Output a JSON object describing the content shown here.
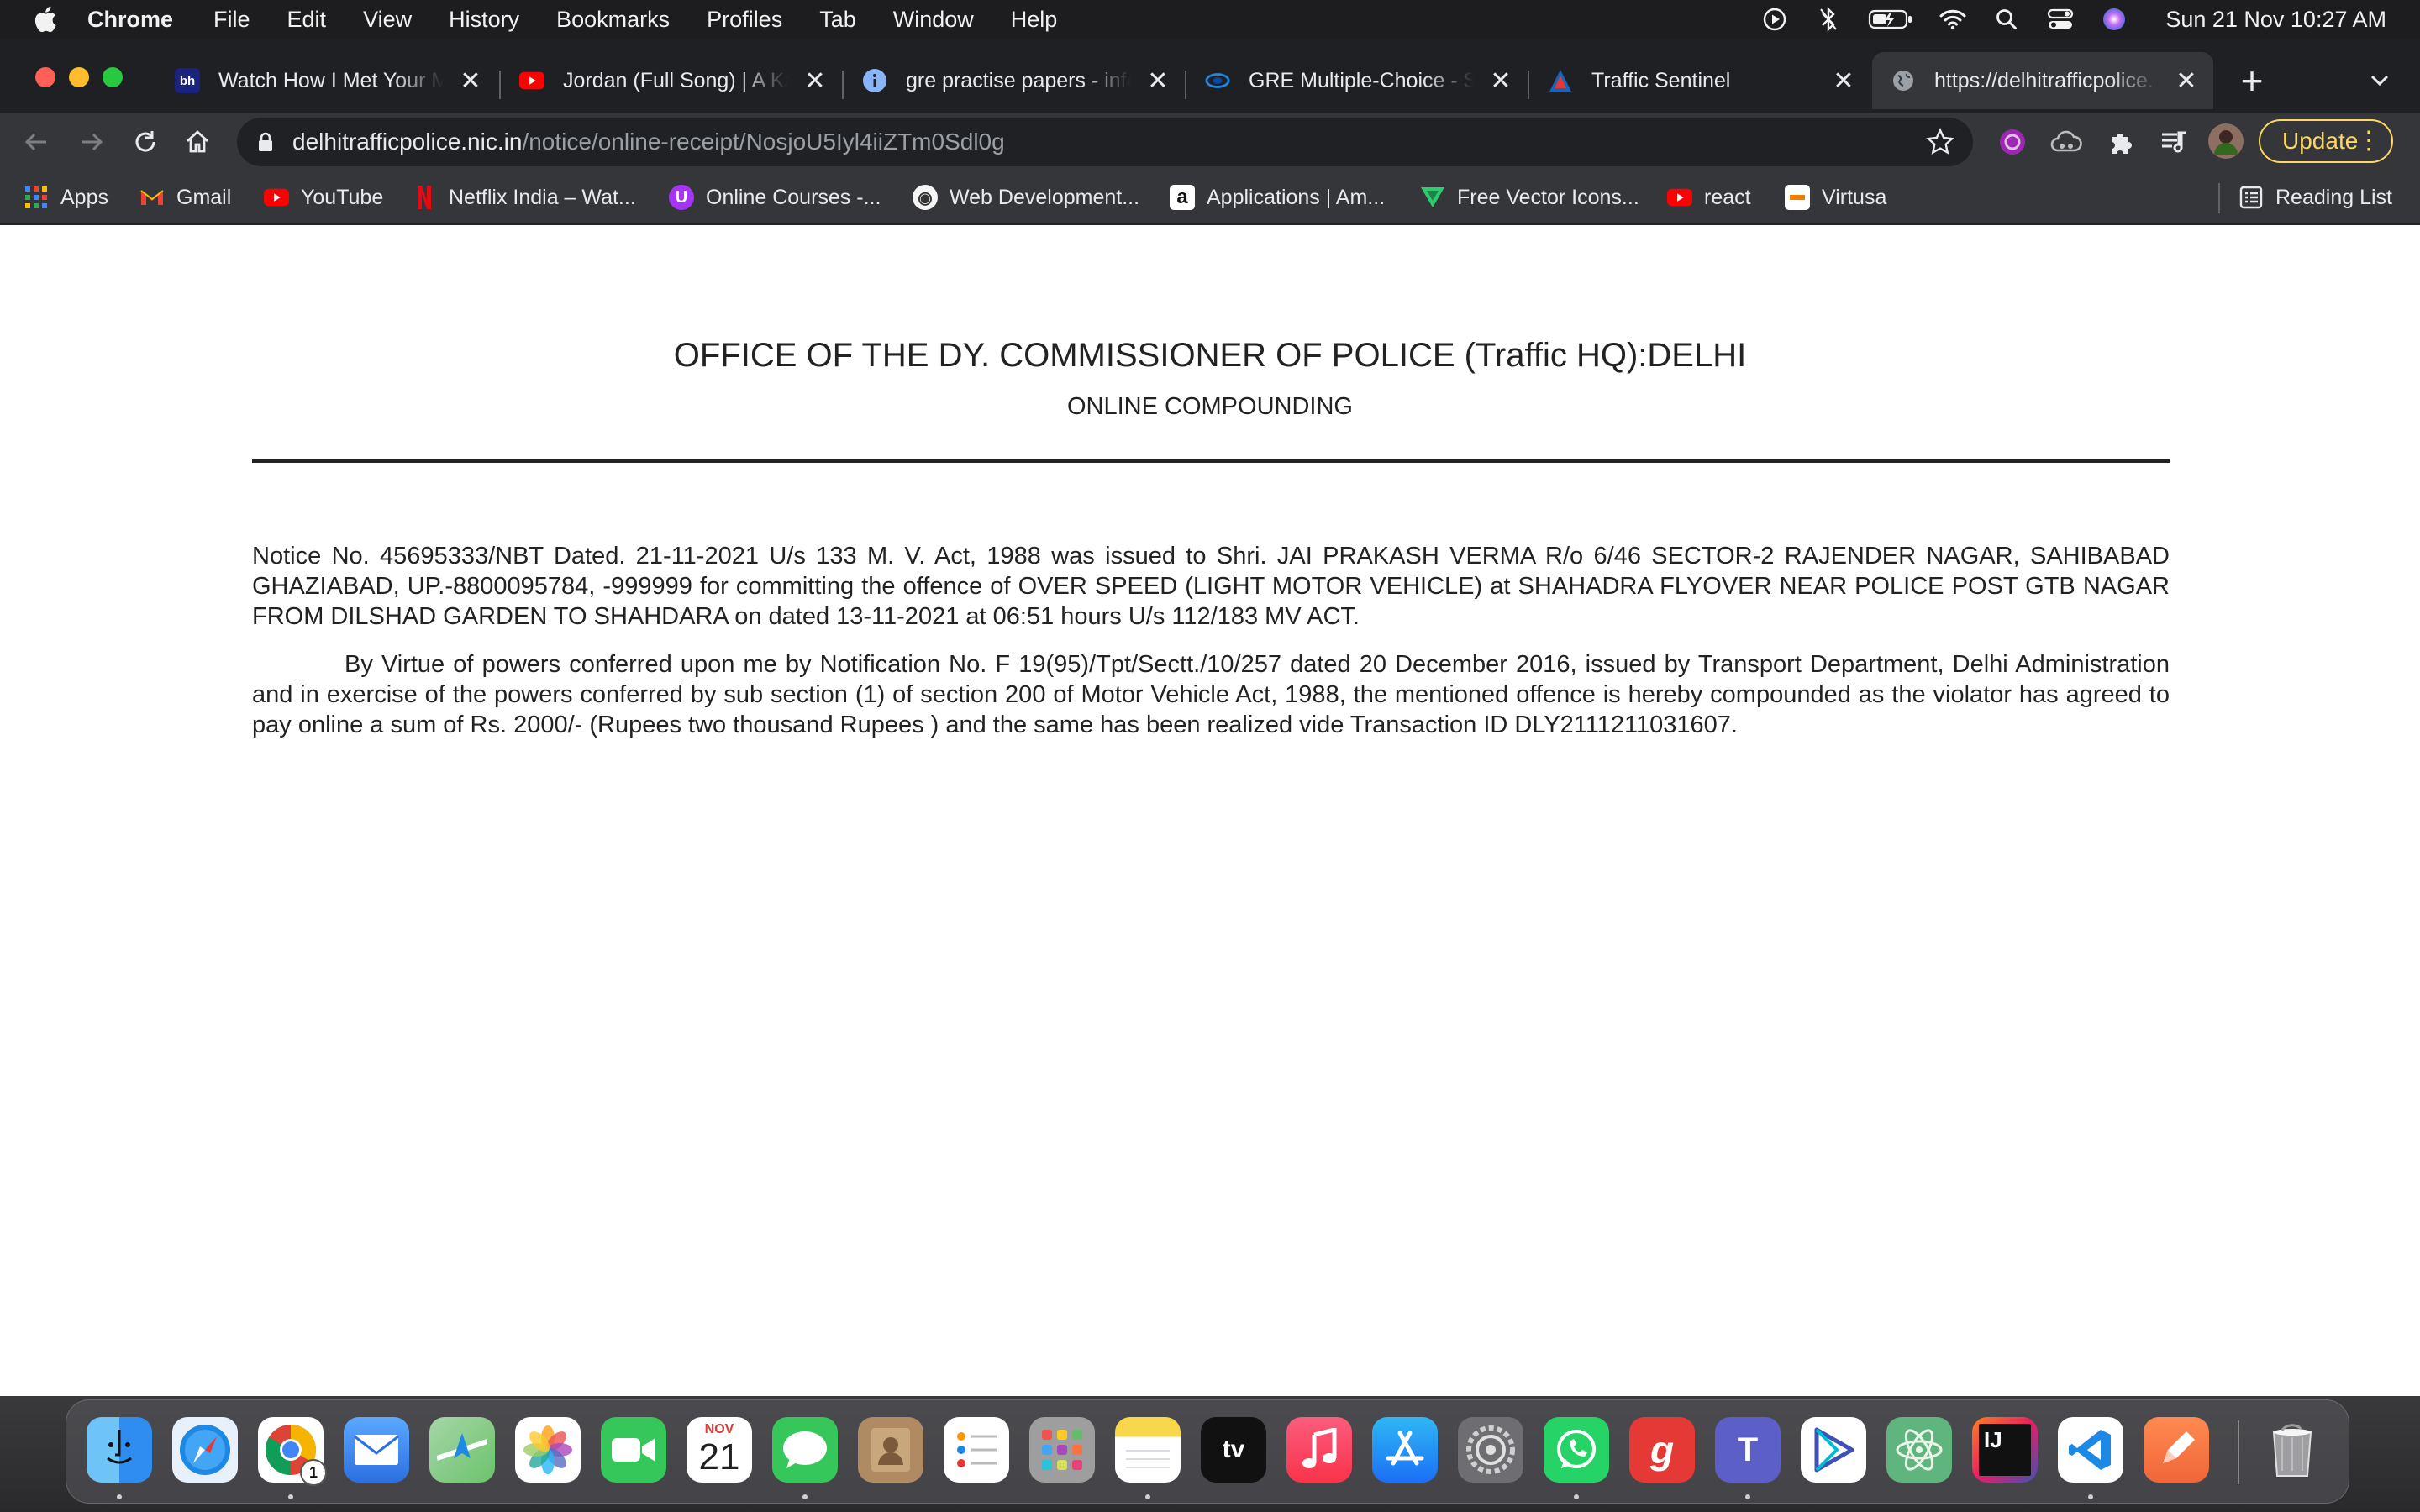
{
  "menubar": {
    "app": "Chrome",
    "items": [
      "File",
      "Edit",
      "View",
      "History",
      "Bookmarks",
      "Profiles",
      "Tab",
      "Window",
      "Help"
    ],
    "status_icons": [
      "play-circle-icon",
      "bluetooth-icon",
      "battery-icon",
      "wifi-icon",
      "spotlight-search-icon",
      "control-center-icon",
      "siri-icon"
    ],
    "clock": "Sun 21 Nov  10:27 AM"
  },
  "tabs": [
    {
      "title": "Watch How I Met Your M",
      "favicon": "bh-favicon",
      "color": "#1a237e"
    },
    {
      "title": "Jordan (Full Song) | A Ka",
      "favicon": "youtube-favicon",
      "color": "#ff0000"
    },
    {
      "title": "gre practise papers - info",
      "favicon": "info-favicon",
      "color": "#8ab4f8"
    },
    {
      "title": "GRE Multiple-Choice - St",
      "favicon": "gre-favicon",
      "color": "#1565c0"
    },
    {
      "title": "Traffic Sentinel",
      "favicon": "traffic-favicon",
      "color": "#c62828"
    },
    {
      "title": "https://delhitrafficpolice.",
      "favicon": "globe-favicon",
      "color": "#9aa0a6"
    }
  ],
  "omnibox": {
    "host": "delhitrafficpolice.nic.in",
    "path": "/notice/online-receipt/NosjoU5Iyl4iiZTm0Sdl0g"
  },
  "update_label": "Update",
  "bookmarks": [
    {
      "label": "Apps",
      "icon": "apps-grid-icon",
      "color": "#4285f4"
    },
    {
      "label": "Gmail",
      "icon": "gmail-icon",
      "color": "#ea4335"
    },
    {
      "label": "YouTube",
      "icon": "youtube-icon",
      "color": "#ff0000"
    },
    {
      "label": "Netflix India – Wat...",
      "icon": "netflix-icon",
      "color": "#e50914"
    },
    {
      "label": "Online Courses -...",
      "icon": "udemy-icon",
      "color": "#a435f0"
    },
    {
      "label": "Web Development...",
      "icon": "web-dev-icon",
      "color": "#f5f5f5"
    },
    {
      "label": "Applications | Am...",
      "icon": "amazon-icon",
      "color": "#ffffff"
    },
    {
      "label": "Free Vector Icons...",
      "icon": "vector-icon",
      "color": "#2ecc71"
    },
    {
      "label": "react",
      "icon": "youtube-icon",
      "color": "#ff0000"
    },
    {
      "label": "Virtusa",
      "icon": "virtusa-icon",
      "color": "#ffffff"
    }
  ],
  "reading_list": "Reading List",
  "page": {
    "title": "OFFICE OF THE DY. COMMISSIONER OF POLICE (Traffic HQ):DELHI",
    "subtitle": "ONLINE COMPOUNDING",
    "para1": "Notice No. 45695333/NBT Dated. 21-11-2021 U/s 133 M. V. Act, 1988 was issued to Shri. JAI PRAKASH VERMA R/o 6/46 SECTOR-2 RAJENDER NAGAR, SAHIBABAD GHAZIABAD, UP.-8800095784, -999999 for committing the offence of OVER SPEED (LIGHT MOTOR VEHICLE) at SHAHADRA FLYOVER NEAR POLICE POST GTB NAGAR FROM DILSHAD GARDEN TO SHAHDARA on dated 13-11-2021 at 06:51 hours U/s 112/183 MV ACT.",
    "para2": "By Virtue of powers conferred upon me by Notification No. F 19(95)/Tpt/Sectt./10/257 dated 20 December 2016, issued by Transport Department, Delhi Administration and in exercise of the powers conferred by sub section (1) of section 200 of Motor Vehicle Act, 1988, the mentioned offence is hereby compounded as the violator has agreed to pay online a sum of Rs. 2000/- (Rupees two thousand Rupees ) and the same has been realized vide Transaction ID DLY2111211031607."
  },
  "dock": {
    "apps": [
      {
        "name": "finder-icon",
        "bg": "#2f8cf0"
      },
      {
        "name": "safari-icon",
        "bg": "#1e88e5"
      },
      {
        "name": "chrome-icon",
        "bg": "#ffffff",
        "badge": "1"
      },
      {
        "name": "mail-icon",
        "bg": "#3d8bfd"
      },
      {
        "name": "maps-icon",
        "bg": "#6cc36c"
      },
      {
        "name": "photos-icon",
        "bg": "#ffffff"
      },
      {
        "name": "facetime-icon",
        "bg": "#35c759"
      },
      {
        "name": "calendar-icon",
        "bg": "#ffffff",
        "month": "NOV",
        "day": "21"
      },
      {
        "name": "messages-icon",
        "bg": "#35c759"
      },
      {
        "name": "contacts-icon",
        "bg": "#b08a63"
      },
      {
        "name": "reminders-icon",
        "bg": "#ffffff"
      },
      {
        "name": "launchpad-icon",
        "bg": "#9e9e9e"
      },
      {
        "name": "notes-icon",
        "bg": "#f8d74a"
      },
      {
        "name": "apple-tv-icon",
        "bg": "#111111",
        "label": "tv"
      },
      {
        "name": "music-icon",
        "bg": "#fa4357"
      },
      {
        "name": "app-store-icon",
        "bg": "#1b8cf5"
      },
      {
        "name": "system-preferences-icon",
        "bg": "#8e8e93"
      },
      {
        "name": "whatsapp-icon",
        "bg": "#25d366"
      },
      {
        "name": "g-app-icon",
        "bg": "#e53935",
        "label": "g"
      },
      {
        "name": "teams-icon",
        "bg": "#5b5fc7",
        "label": "T"
      },
      {
        "name": "play-icon",
        "bg": "#ffffff"
      },
      {
        "name": "atom-icon",
        "bg": "#5fb57d"
      },
      {
        "name": "intellij-icon",
        "bg": "#111111",
        "label": "IJ"
      },
      {
        "name": "vscode-icon",
        "bg": "#ffffff"
      },
      {
        "name": "pen-app-icon",
        "bg": "#f0663a"
      },
      {
        "name": "trash-icon",
        "bg": "transparent"
      }
    ]
  }
}
